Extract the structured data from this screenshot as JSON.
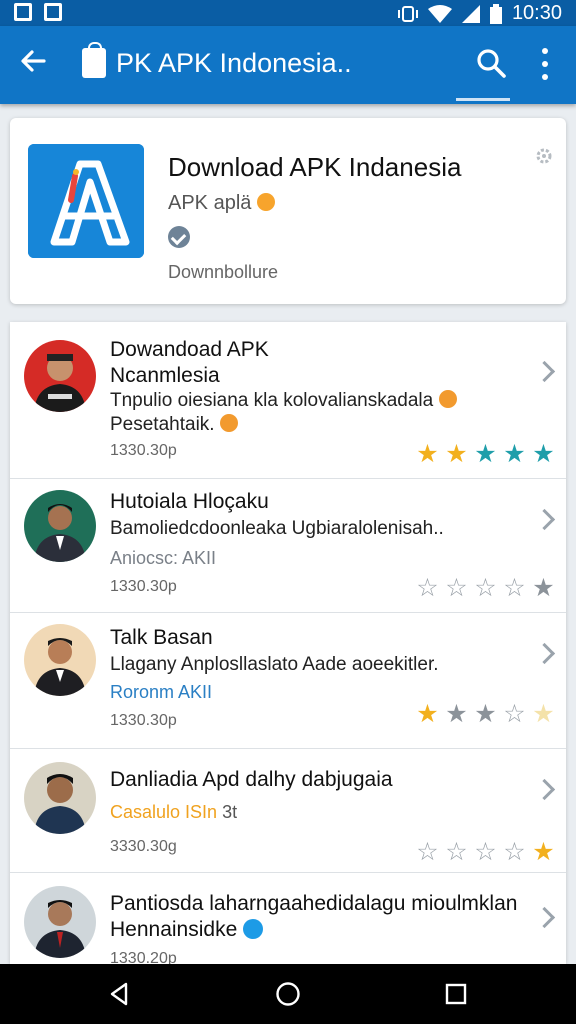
{
  "status_bar": {
    "time": "10:30"
  },
  "app_bar": {
    "title": "PK APK Indonesia.."
  },
  "app_card": {
    "name": "Download APK Indanesia",
    "subtitle": "APK aplä",
    "downloads_label": "Downnbollure"
  },
  "reviews": [
    {
      "title_line1": "Dowandoad APK",
      "title_line2": "Ncanmlesia",
      "body_line1": "Tnpulio oiesiana kla kolovalianskadala",
      "body_line2": "Pesetahtaik.",
      "date": "1330.30p",
      "rating_stars": [
        "gold",
        "gold",
        "teal",
        "teal",
        "teal"
      ]
    },
    {
      "title": "Hutoiala Hloçaku",
      "body": "Bamoliedcdoonleaka Ugbiaralolenisah..",
      "secondary": "Aniocsc: AKII",
      "date": "1330.30p",
      "rating_stars": [
        "outline",
        "outline",
        "outline",
        "outline",
        "gray"
      ]
    },
    {
      "title": "Talk Basan",
      "body": "Llagany Anplosllaslato Aade aoeekitler.",
      "secondary": "Roronm AKII",
      "date": "1330.30p",
      "rating_stars": [
        "gold",
        "gray",
        "gray",
        "outline",
        "pale"
      ]
    },
    {
      "title": "Danliadia Apd dalhy dabjugaia",
      "secondary": "Casalulo ISIn",
      "secondary_extra": "3t",
      "date": "3330.30g",
      "rating_stars": [
        "outline",
        "outline",
        "outline",
        "outline",
        "gold"
      ]
    },
    {
      "title": "Pantiosda laharngaahedidalagu mioulmklan",
      "body": "Hennainsidke",
      "date": "1330.20p"
    }
  ],
  "colors": {
    "app_bar": "#1075c6",
    "status_bar": "#0a5da4",
    "star_gold": "#f2b01e",
    "star_teal": "#1f9eaa",
    "link_blue": "#2a7fc4",
    "accent_orange": "#f0a21f"
  }
}
